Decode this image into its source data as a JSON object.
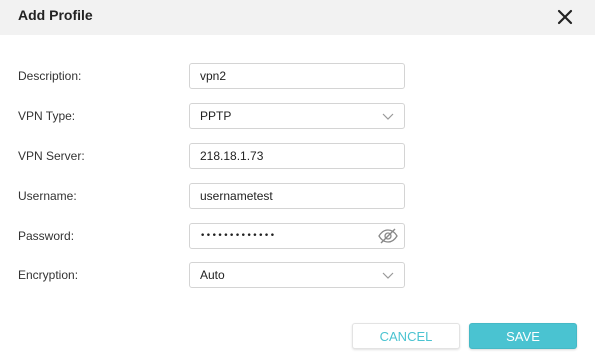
{
  "dialog": {
    "title": "Add Profile",
    "close_icon": "close-icon"
  },
  "form": {
    "description": {
      "label": "Description:",
      "value": "vpn2"
    },
    "vpn_type": {
      "label": "VPN Type:",
      "value": "PPTP",
      "icon": "chevron-down-icon"
    },
    "vpn_server": {
      "label": "VPN Server:",
      "value": "218.18.1.73"
    },
    "username": {
      "label": "Username:",
      "value": "usernametest"
    },
    "password": {
      "label": "Password:",
      "value": "•••••••••••••",
      "icon": "eye-slash-icon"
    },
    "encryption": {
      "label": "Encryption:",
      "value": "Auto",
      "icon": "chevron-down-icon"
    }
  },
  "buttons": {
    "cancel_label": "CANCEL",
    "save_label": "SAVE"
  },
  "colors": {
    "accent": "#4ac3d1",
    "header_bg": "#f2f2f2",
    "border": "#d4d4d4"
  }
}
